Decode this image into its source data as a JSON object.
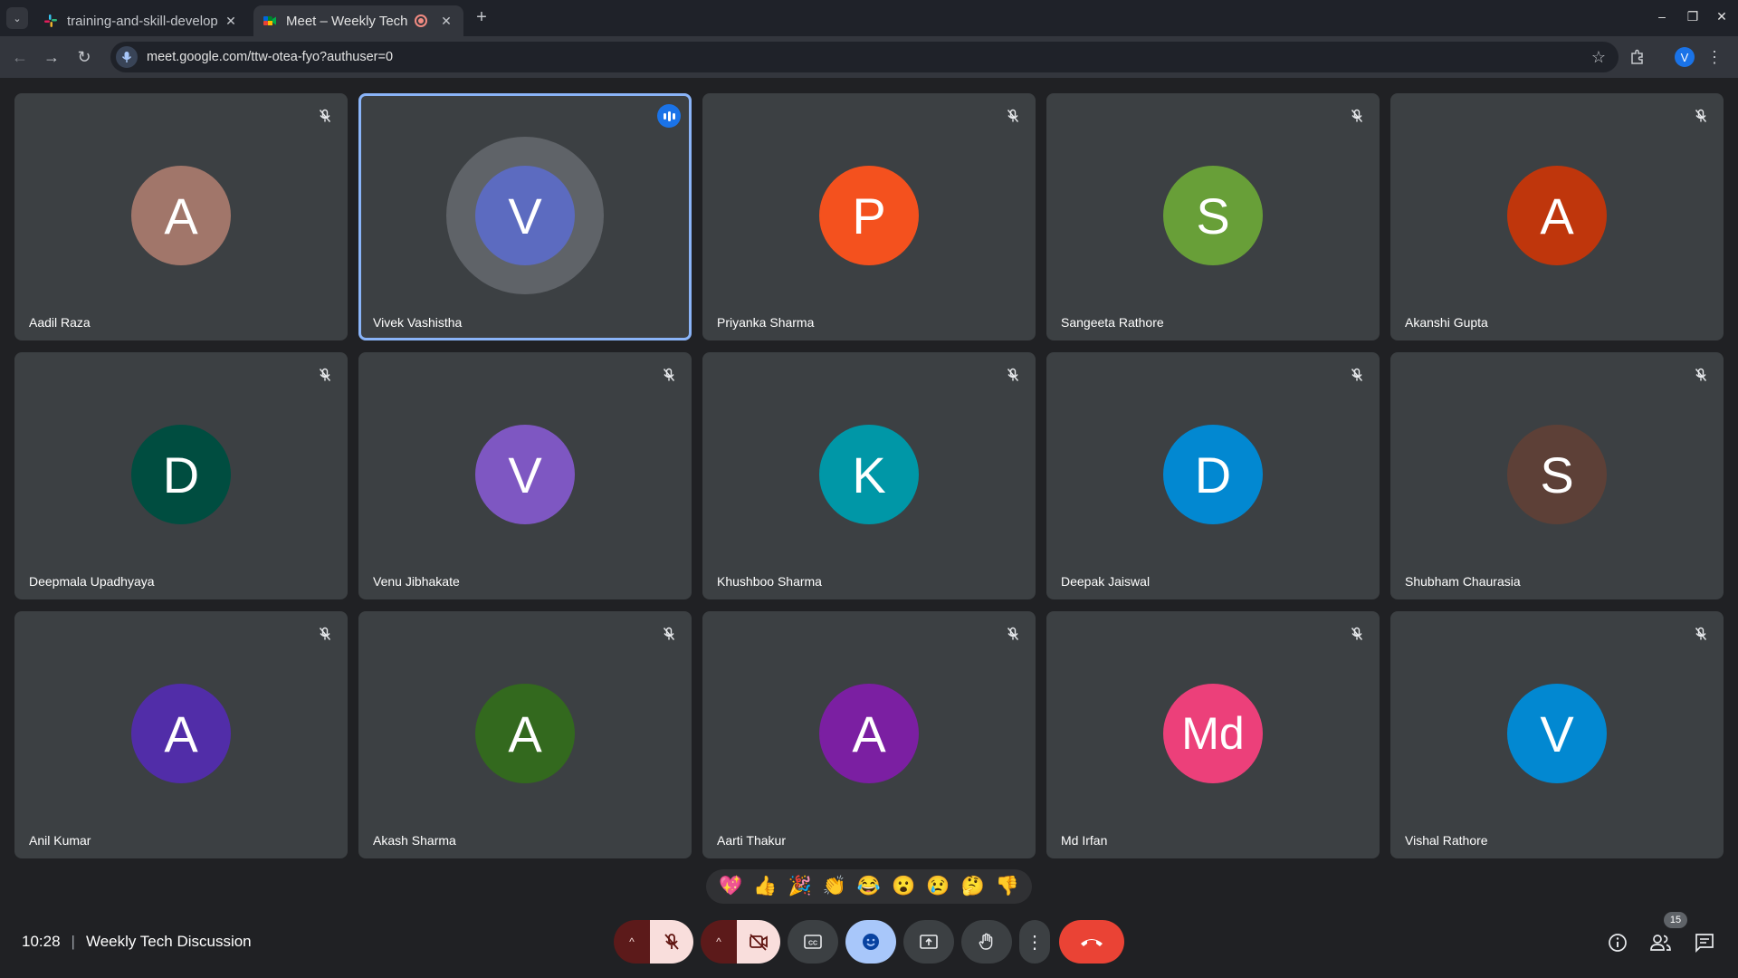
{
  "browser": {
    "tabs": [
      {
        "title": "training-and-skill-develop",
        "active": false
      },
      {
        "title": "Meet – Weekly Tech D",
        "active": true
      }
    ],
    "url": "meet.google.com/ttw-otea-fyo?authuser=0",
    "profile_initial": "V"
  },
  "participants": [
    {
      "name": "Aadil Raza",
      "initial": "A",
      "color": "#a1766a",
      "speaking": false
    },
    {
      "name": "Vivek Vashistha",
      "initial": "V",
      "color": "#5c6bc0",
      "speaking": true
    },
    {
      "name": "Priyanka Sharma",
      "initial": "P",
      "color": "#f4511e",
      "speaking": false
    },
    {
      "name": "Sangeeta Rathore",
      "initial": "S",
      "color": "#689f38",
      "speaking": false
    },
    {
      "name": "Akanshi Gupta",
      "initial": "A",
      "color": "#bf360c",
      "speaking": false
    },
    {
      "name": "Deepmala Upadhyaya",
      "initial": "D",
      "color": "#004d40",
      "speaking": false
    },
    {
      "name": "Venu Jibhakate",
      "initial": "V",
      "color": "#7e57c2",
      "speaking": false
    },
    {
      "name": "Khushboo Sharma",
      "initial": "K",
      "color": "#0097a7",
      "speaking": false
    },
    {
      "name": "Deepak Jaiswal",
      "initial": "D",
      "color": "#0288d1",
      "speaking": false
    },
    {
      "name": "Shubham Chaurasia",
      "initial": "S",
      "color": "#5d4037",
      "speaking": false
    },
    {
      "name": "Anil Kumar",
      "initial": "A",
      "color": "#512da8",
      "speaking": false
    },
    {
      "name": "Akash Sharma",
      "initial": "A",
      "color": "#33691e",
      "speaking": false
    },
    {
      "name": "Aarti Thakur",
      "initial": "A",
      "color": "#7b1fa2",
      "speaking": false
    },
    {
      "name": "Md Irfan",
      "initial": "Md",
      "color": "#ec407a",
      "speaking": false
    },
    {
      "name": "Vishal Rathore",
      "initial": "V",
      "color": "#0288d1",
      "speaking": false
    }
  ],
  "reactions": [
    "💖",
    "👍",
    "🎉",
    "👏",
    "😂",
    "😮",
    "😢",
    "🤔",
    "👎"
  ],
  "meeting": {
    "time": "10:28",
    "title": "Weekly Tech Discussion",
    "participant_count": "15"
  },
  "icons": {
    "mic": "mic-off-icon",
    "camera": "camera-off-icon",
    "captions": "captions-icon",
    "emoji": "emoji-icon",
    "present": "present-icon",
    "hand": "raise-hand-icon",
    "more": "more-options-icon",
    "leave": "leave-call-icon",
    "info": "info-icon",
    "people": "people-icon",
    "chat": "chat-icon"
  },
  "colors": {
    "speaking_outline": "#8ab4f8",
    "leave_red": "#ea4335",
    "muted_red": "#f9dedc",
    "emoji_active": "#a8c7fa"
  }
}
